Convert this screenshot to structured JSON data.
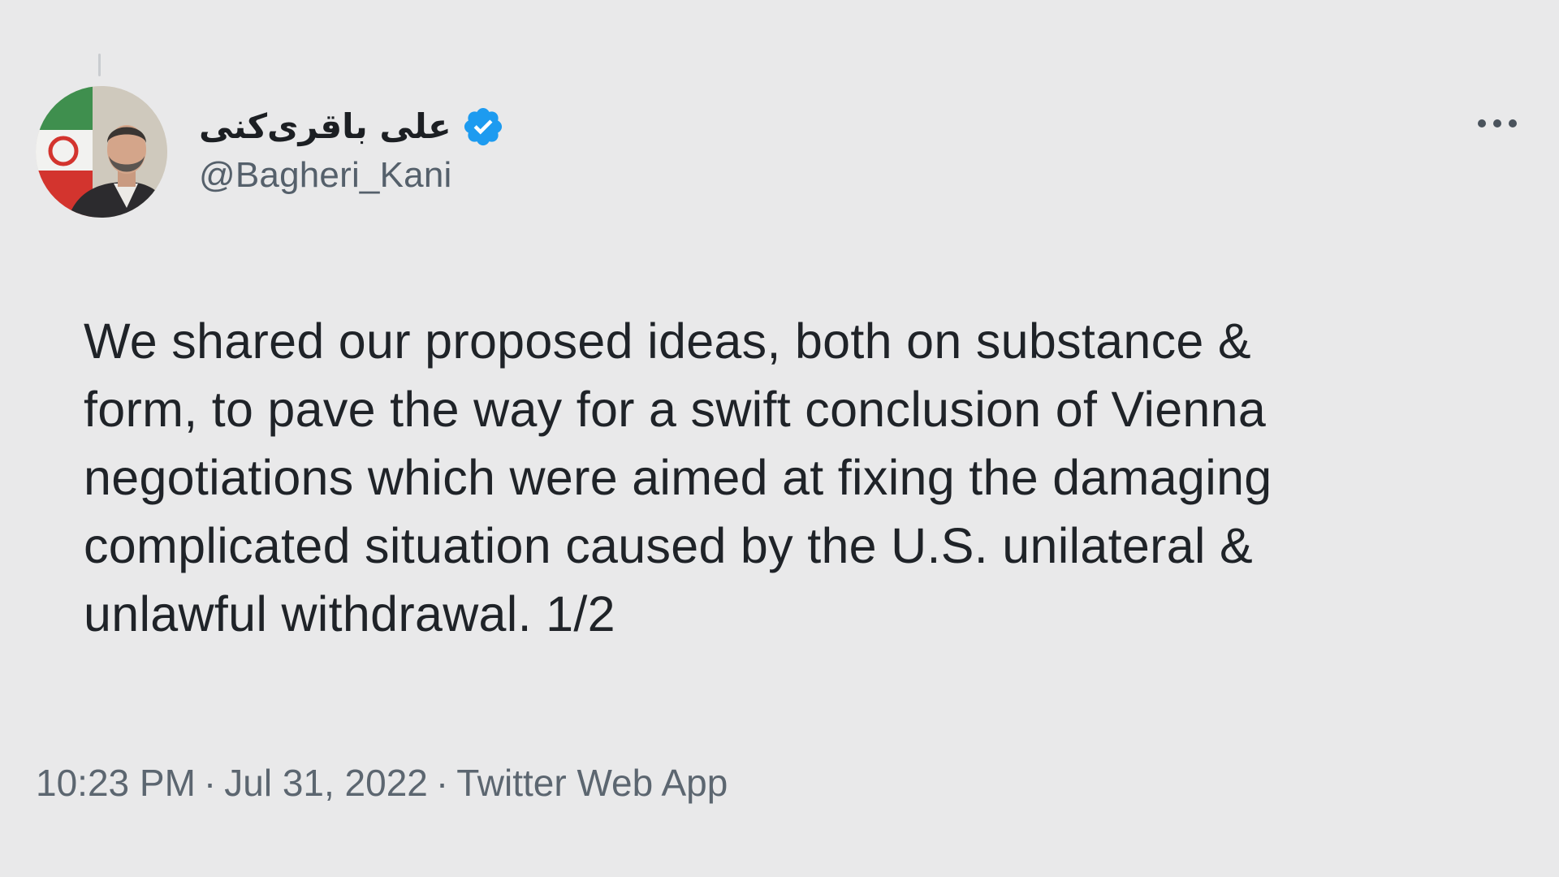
{
  "author": {
    "display_name": "علی باقری‌کنی",
    "handle": "@Bagheri_Kani",
    "verified": true
  },
  "tweet": {
    "lines": [
      "We shared our proposed ideas, both on substance &",
      "form, to pave the way for a swift conclusion of Vienna",
      "negotiations which were aimed at fixing the damaging",
      "complicated situation caused by the U.S. unilateral &",
      "unlawful withdrawal. 1/2"
    ]
  },
  "meta": {
    "time": "10:23 PM",
    "separator": "·",
    "date": "Jul 31, 2022",
    "source": "Twitter Web App"
  },
  "icons": {
    "verified": "verified-badge-icon",
    "more": "more-horizontal-icon"
  },
  "colors": {
    "background": "#e9e9ea",
    "verified_blue": "#1d9bf0",
    "text": "#1f2328",
    "muted": "#5c6670"
  }
}
